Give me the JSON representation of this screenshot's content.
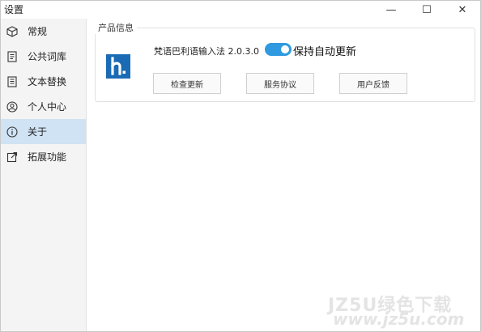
{
  "window": {
    "title": "设置",
    "controls": {
      "minimize": "—",
      "maximize": "☐",
      "close": "✕"
    }
  },
  "sidebar": {
    "items": [
      {
        "label": "常规",
        "icon": "cube-icon",
        "active": false
      },
      {
        "label": "公共词库",
        "icon": "dictionary-icon",
        "active": false
      },
      {
        "label": "文本替换",
        "icon": "text-replace-icon",
        "active": false
      },
      {
        "label": "个人中心",
        "icon": "user-icon",
        "active": false
      },
      {
        "label": "关于",
        "icon": "info-icon",
        "active": true
      },
      {
        "label": "拓展功能",
        "icon": "external-link-icon",
        "active": false
      }
    ]
  },
  "product": {
    "group_title": "产品信息",
    "logo_letter": "h",
    "name": "梵语巴利语输入法 2.0.3.0",
    "auto_update_label": "保持自动更新",
    "auto_update_on": true,
    "buttons": {
      "check_update": "检查更新",
      "service_agreement": "服务协议",
      "feedback": "用户反馈"
    }
  },
  "watermark": {
    "line1": "JZ5U绿色下载",
    "line2": "www.jz5u.com"
  },
  "colors": {
    "accent": "#2f9ae0",
    "active_nav": "#cfe3f4",
    "logo_bg": "#1b6bb4"
  }
}
